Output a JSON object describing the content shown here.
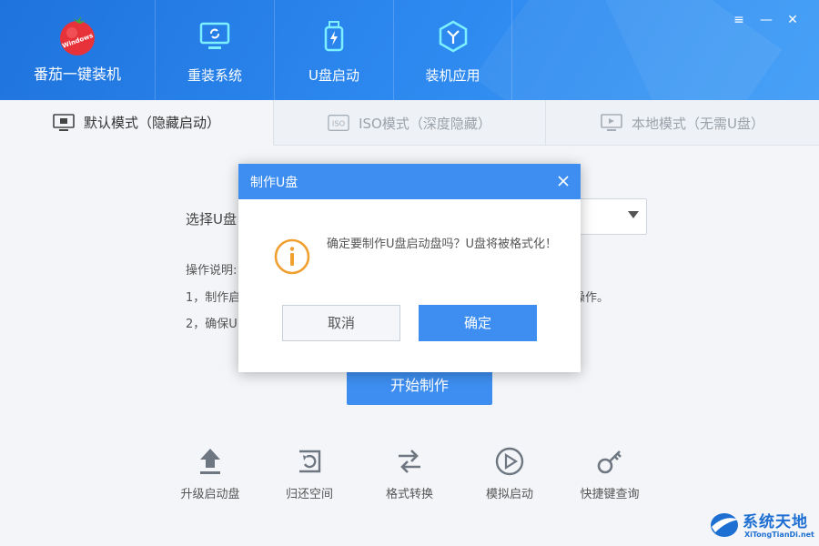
{
  "app": {
    "title": "番茄一键装机",
    "logo_text": "Windows"
  },
  "nav": [
    {
      "label": "重装系统",
      "icon": "monitor-refresh-icon"
    },
    {
      "label": "U盘启动",
      "icon": "usb-drive-icon"
    },
    {
      "label": "装机应用",
      "icon": "hexagon-y-icon"
    }
  ],
  "window_controls": {
    "menu": "≡",
    "minimize": "—",
    "close": "✕"
  },
  "tabs": [
    {
      "label": "默认模式（隐藏启动）",
      "state": "active"
    },
    {
      "label": "ISO模式（深度隐藏）",
      "state": "inactive",
      "icon_text": "ISO"
    },
    {
      "label": "本地模式（无需U盘）",
      "state": "inactive"
    }
  ],
  "main": {
    "select_label": "选择U盘",
    "instructions_title": "操作说明:",
    "instruction_1": "1，制作启",
    "instruction_1_tail": "操作。",
    "instruction_2": "2，确保U",
    "start_button": "开始制作"
  },
  "tools": [
    {
      "label": "升级启动盘",
      "icon": "upload-arrow-icon"
    },
    {
      "label": "归还空间",
      "icon": "restore-space-icon"
    },
    {
      "label": "格式转换",
      "icon": "swap-arrows-icon"
    },
    {
      "label": "模拟启动",
      "icon": "play-circle-icon"
    },
    {
      "label": "快捷键查询",
      "icon": "key-icon"
    }
  ],
  "dialog": {
    "title": "制作U盘",
    "message": "确定要制作U盘启动盘吗？U盘将被格式化！",
    "cancel": "取消",
    "ok": "确定"
  },
  "watermark": {
    "title": "系统天地",
    "subtitle": "XiTongTianDi.net"
  },
  "colors": {
    "primary": "#3d8ef0",
    "header": "#2b86ee",
    "warning": "#f0a030"
  }
}
